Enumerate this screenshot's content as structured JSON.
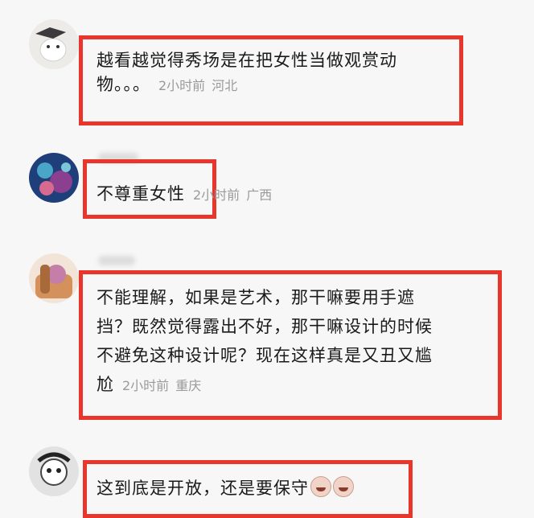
{
  "comments": [
    {
      "text_line1": "越看越觉得秀场是在把女性当做观赏动",
      "text_line2": "物。。。",
      "time": "2小时前",
      "location": "河北"
    },
    {
      "text": "不尊重女性",
      "time": "2小时前",
      "location": "广西"
    },
    {
      "text_line1": "不能理解，如果是艺术，那干嘛要用手遮",
      "text_line2": "挡？既然觉得露出不好，那干嘛设计的时候",
      "text_line3": "不避免这种设计呢？现在这样真是又丑又尴",
      "text_line4": "尬",
      "time": "2小时前",
      "location": "重庆"
    },
    {
      "text": "这到底是开放，还是要保守",
      "emojis": [
        "crying-face-icon",
        "crying-face-icon"
      ]
    }
  ],
  "colors": {
    "highlight": "#e8362c",
    "meta": "#9a9a9a",
    "background": "#f7f7f7"
  }
}
